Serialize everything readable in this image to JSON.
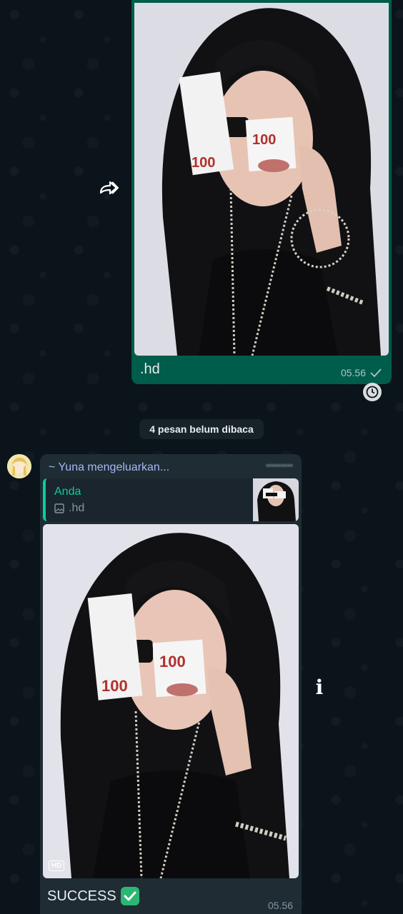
{
  "outgoing_message": {
    "caption": ".hd",
    "time": "05.56",
    "status": "sent-check",
    "photo_icon": "woman-with-money-photo"
  },
  "unread_divider": {
    "label": "4 pesan belum dibaca"
  },
  "incoming_message": {
    "sender": "~ Yuna mengeluarkan...",
    "quote": {
      "author": "Anda",
      "text": ".hd"
    },
    "hd_badge": "HD",
    "caption": "SUCCESS",
    "time": "05.56"
  },
  "colors": {
    "background": "#0b141a",
    "outgoing_bubble": "#005c4b",
    "incoming_bubble": "#1f2c34",
    "quote_accent": "#06cf9c",
    "sender_name": "#a5b9f5"
  }
}
